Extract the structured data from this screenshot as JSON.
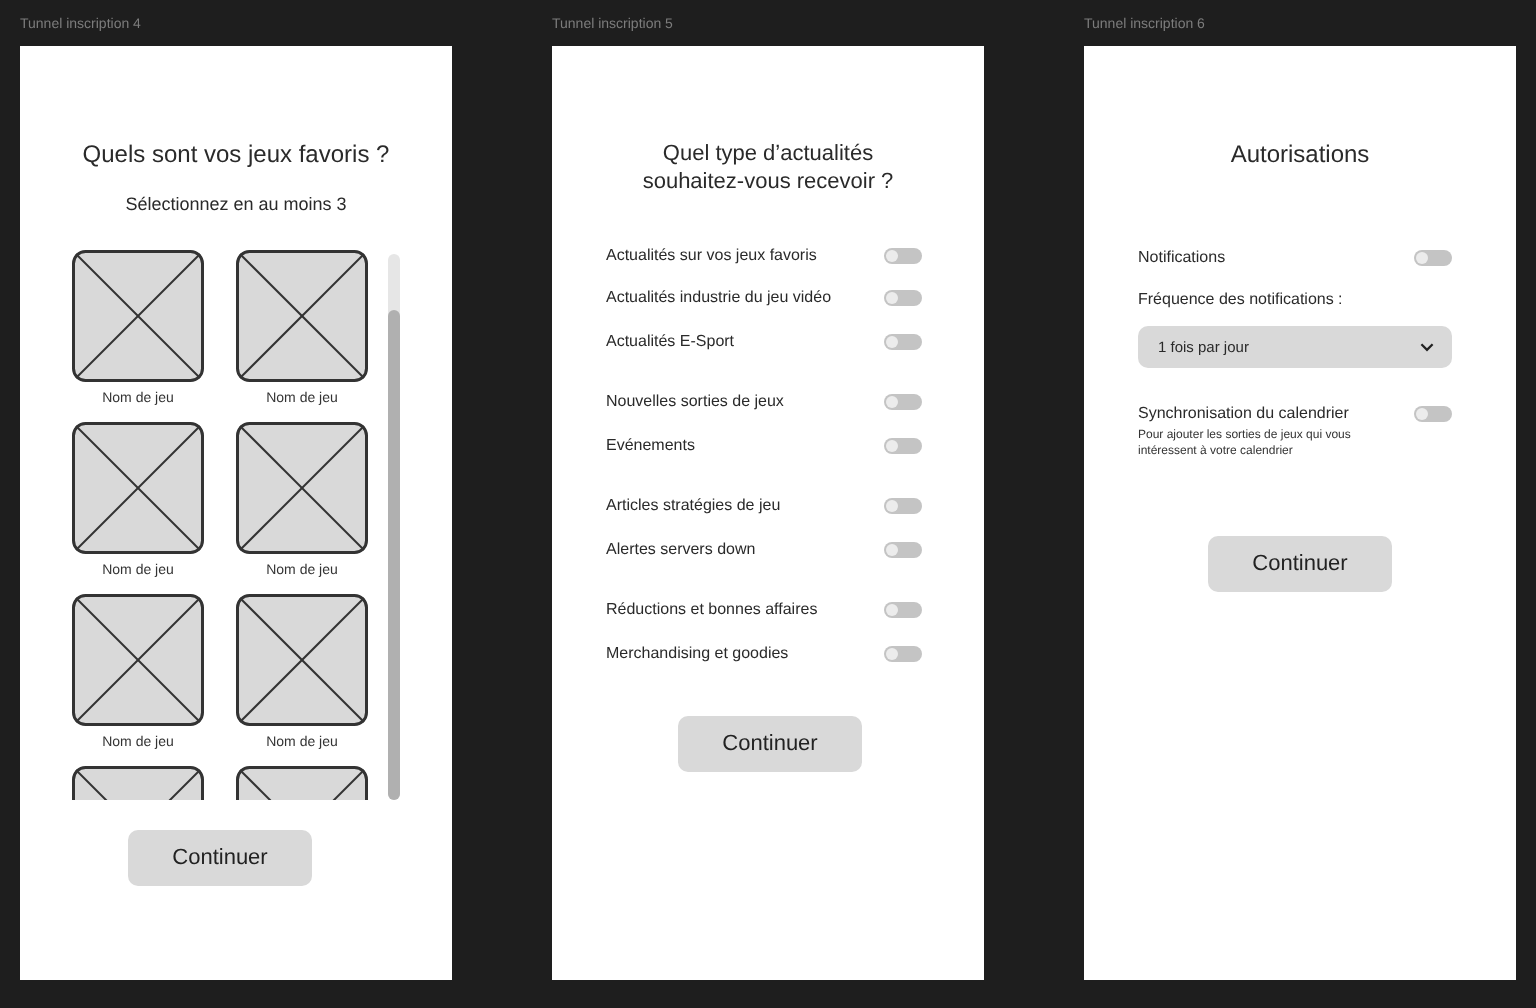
{
  "frames": [
    {
      "kind": "games",
      "label": "Tunnel inscription 4",
      "title": "Quels sont vos jeux favoris ?",
      "subtitle": "Sélectionnez en au moins 3",
      "games": [
        {
          "kind": "game",
          "name": "Nom de jeu"
        },
        {
          "kind": "game",
          "name": "Nom de jeu"
        },
        {
          "kind": "game",
          "name": "Nom de jeu"
        },
        {
          "kind": "game",
          "name": "Nom de jeu"
        },
        {
          "kind": "game",
          "name": "Nom de jeu"
        },
        {
          "kind": "game",
          "name": "Nom de jeu"
        },
        {
          "kind": "picture"
        },
        {
          "kind": "picture"
        }
      ],
      "button": "Continuer"
    },
    {
      "kind": "news",
      "label": "Tunnel inscription 5",
      "title": "Quel type d’actualités souhaitez-vous recevoir ?",
      "groups": [
        [
          {
            "label": "Actualités sur vos jeux favoris",
            "on": false
          },
          {
            "label": "Actualités industrie du jeu vidéo",
            "on": false
          },
          {
            "label": "Actualités E-Sport",
            "on": false
          }
        ],
        [
          {
            "label": "Nouvelles sorties de jeux",
            "on": false
          },
          {
            "label": "Evénements",
            "on": false
          }
        ],
        [
          {
            "label": "Articles stratégies de jeu",
            "on": false
          },
          {
            "label": "Alertes servers down",
            "on": false
          }
        ],
        [
          {
            "label": "Réductions et bonnes affaires",
            "on": false
          },
          {
            "label": "Merchandising et goodies",
            "on": false
          }
        ]
      ],
      "button": "Continuer"
    },
    {
      "kind": "permissions",
      "label": "Tunnel inscription 6",
      "title": "Autorisations",
      "notifications": {
        "label": "Notifications",
        "on": false
      },
      "frequency": {
        "label": "Fréquence des notifications :",
        "value": "1 fois par jour"
      },
      "calendar": {
        "label": "Synchronisation du calendrier",
        "description": "Pour ajouter les sorties de jeux qui vous intéressent à votre calendrier",
        "on": false
      },
      "button": "Continuer"
    }
  ]
}
